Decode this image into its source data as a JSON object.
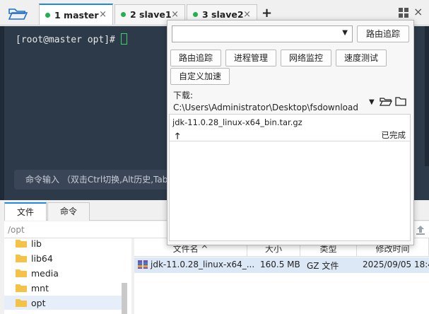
{
  "tabs": [
    {
      "label": "1 master",
      "close": "×"
    },
    {
      "label": "2 slave1",
      "close": "×"
    },
    {
      "label": "3 slave2",
      "close": "×"
    }
  ],
  "new_tab": "+",
  "close_all": "×",
  "terminal": {
    "prompt": "[root@master opt]#",
    "command_hint": "命令输入 （双击Ctrl切换,Alt历史,Tab"
  },
  "popup": {
    "trace_button": "路由追踪",
    "tool_buttons": [
      "路由追踪",
      "进程管理",
      "网络监控",
      "速度测试"
    ],
    "custom_button": "自定义加速",
    "download_label": "下载: C:\\Users\\Administrator\\Desktop\\fsdownload",
    "download_item": {
      "name": "jdk-11.0.28_linux-x64_bin.tar.gz",
      "direction_icon": "🡑",
      "status": "已完成"
    }
  },
  "bottom": {
    "tabs": [
      "文件",
      "命令"
    ],
    "path": "/opt",
    "tree": [
      "lib",
      "lib64",
      "media",
      "mnt",
      "opt"
    ],
    "columns": [
      "文件名 ^",
      "大小",
      "类型",
      "修改时间"
    ],
    "files": [
      {
        "name": "jdk-11.0.28_linux-x64_...",
        "size": "160.5 MB",
        "type": "GZ 文件",
        "modified": "2025/09/05 18:4"
      }
    ]
  },
  "colors": {
    "terminal_bg": "#2d3a4a",
    "accent": "#1e88e5",
    "status_dot": "#22b14c",
    "cursor": "#3bd16f"
  }
}
